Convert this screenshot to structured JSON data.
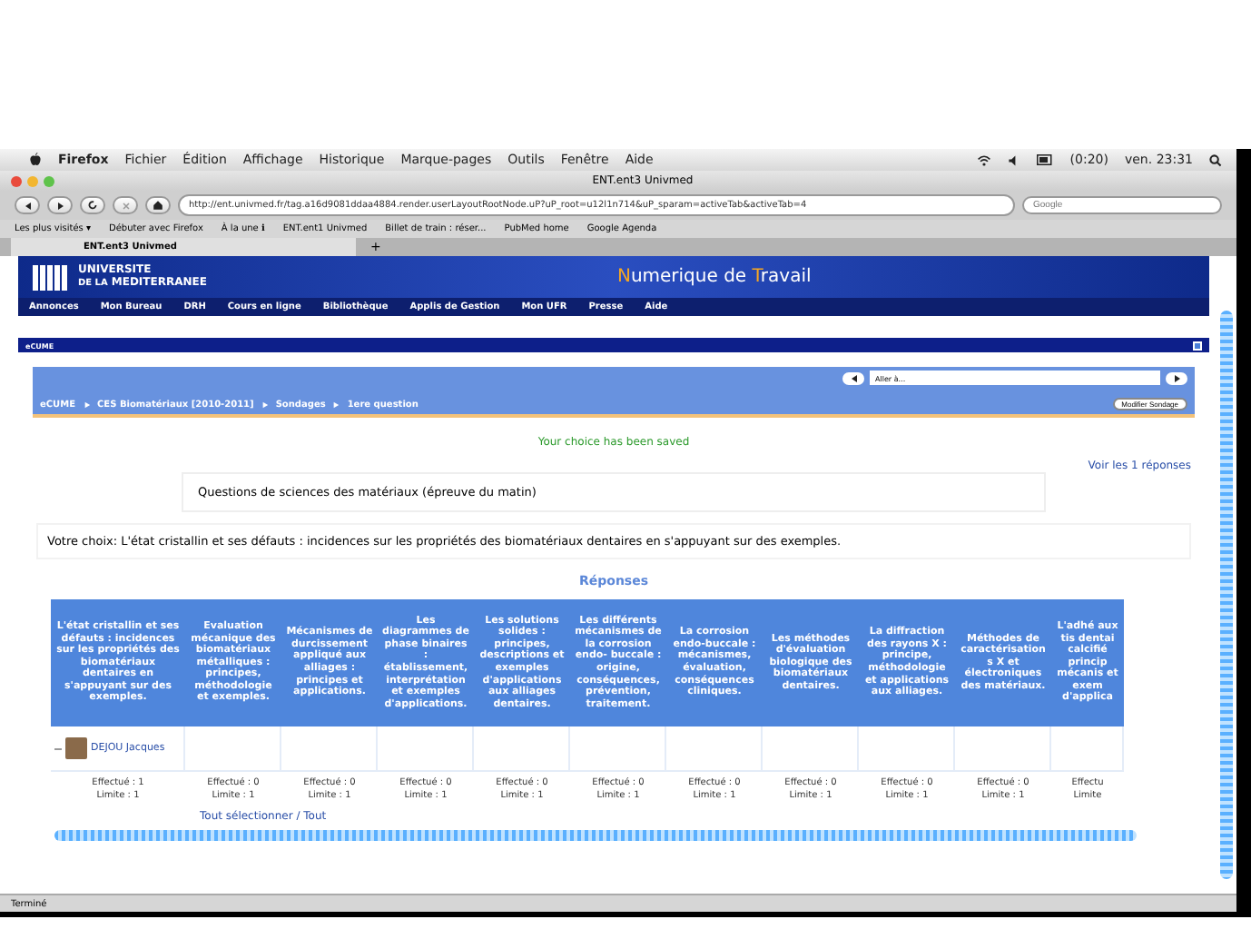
{
  "menubar": {
    "app": "Firefox",
    "menus": [
      "Fichier",
      "Édition",
      "Affichage",
      "Historique",
      "Marque-pages",
      "Outils",
      "Fenêtre",
      "Aide"
    ],
    "battery": "(0:20)",
    "clock": "ven. 23:31"
  },
  "window": {
    "title": "ENT.ent3 Univmed"
  },
  "toolbar": {
    "url": "http://ent.univmed.fr/tag.a16d9081ddaa4884.render.userLayoutRootNode.uP?uP_root=u12l1n714&uP_sparam=activeTab&activeTab=4",
    "search_placeholder": "Google"
  },
  "bookmarks": [
    "Les plus visités ▾",
    "Débuter avec Firefox",
    "À la une ℹ",
    "ENT.ent1 Univmed",
    "Billet de train : réser...",
    "PubMed home",
    "Google Agenda"
  ],
  "tabs": [
    {
      "label": "ENT.ent3 Univmed",
      "selected": true
    }
  ],
  "new_tab": "+",
  "banner": {
    "logo_top": "UNIVERSITE",
    "logo_small": "DE LA",
    "logo_bottom": "MEDITERRANEE",
    "title": [
      {
        "text": "N",
        "accent": true
      },
      {
        "text": "umerique de ",
        "accent": false
      },
      {
        "text": "T",
        "accent": true
      },
      {
        "text": "ravail",
        "accent": false
      }
    ]
  },
  "nav": [
    "Annonces",
    "Mon Bureau",
    "DRH",
    "Cours en ligne",
    "Bibliothèque",
    "Applis de Gestion",
    "Mon UFR",
    "Presse",
    "Aide"
  ],
  "portlet": {
    "title": "eCUME",
    "goto_placeholder": "Aller à...",
    "breadcrumb": [
      "eCUME",
      "CES Biomatériaux [2010-2011]",
      "Sondages",
      "1ere question"
    ],
    "edit_button": "Modifier Sondage"
  },
  "poll": {
    "message": "Your choice has been saved",
    "view_link": "Voir les 1 réponses",
    "question": "Questions de sciences des matériaux (épreuve du matin)",
    "choice": "Votre choix: L'état cristallin et ses défauts : incidences sur les propriétés des biomatériaux dentaires en s'appuyant sur des exemples.",
    "answers_title": "Réponses"
  },
  "table": {
    "columns": [
      {
        "header": "L'état cristallin et ses défauts : incidences sur les propriétés des biomatériaux dentaires en s'appuyant sur des exemples.",
        "done": "Effectué : 1",
        "limit": "Limite : 1"
      },
      {
        "header": "Evaluation mécanique des biomatériaux métalliques : principes, méthodologie et exemples.",
        "done": "Effectué : 0",
        "limit": "Limite : 1"
      },
      {
        "header": "Mécanismes de durcissement appliqué aux alliages : principes et applications.",
        "done": "Effectué : 0",
        "limit": "Limite : 1"
      },
      {
        "header": "Les diagrammes de phase binaires : établissement, interprétation et exemples d'applications.",
        "done": "Effectué : 0",
        "limit": "Limite : 1"
      },
      {
        "header": "Les solutions solides : principes, descriptions et exemples d'applications aux alliages dentaires.",
        "done": "Effectué : 0",
        "limit": "Limite : 1"
      },
      {
        "header": "Les différents mécanismes de la corrosion endo- buccale : origine, conséquences, prévention, traitement.",
        "done": "Effectué : 0",
        "limit": "Limite : 1"
      },
      {
        "header": "La corrosion endo-buccale : mécanismes, évaluation, conséquences cliniques.",
        "done": "Effectué : 0",
        "limit": "Limite : 1"
      },
      {
        "header": "Les méthodes d'évaluation biologique des biomatériaux dentaires.",
        "done": "Effectué : 0",
        "limit": "Limite : 1"
      },
      {
        "header": "La diffraction des rayons X : principe, méthodologie et applications aux alliages.",
        "done": "Effectué : 0",
        "limit": "Limite : 1"
      },
      {
        "header": "Méthodes de caractérisations X et électroniques des matériaux.",
        "done": "Effectué : 0",
        "limit": "Limite : 1"
      },
      {
        "header": "L'adhé aux tis dentai calcifié princip mécanis et exem d'applica",
        "done": "Effectu",
        "limit": "Limite"
      }
    ],
    "rows": [
      {
        "user": "DEJOU Jacques"
      }
    ],
    "select_all": "Tout sélectionner / Tout"
  },
  "status_bar": "Terminé"
}
